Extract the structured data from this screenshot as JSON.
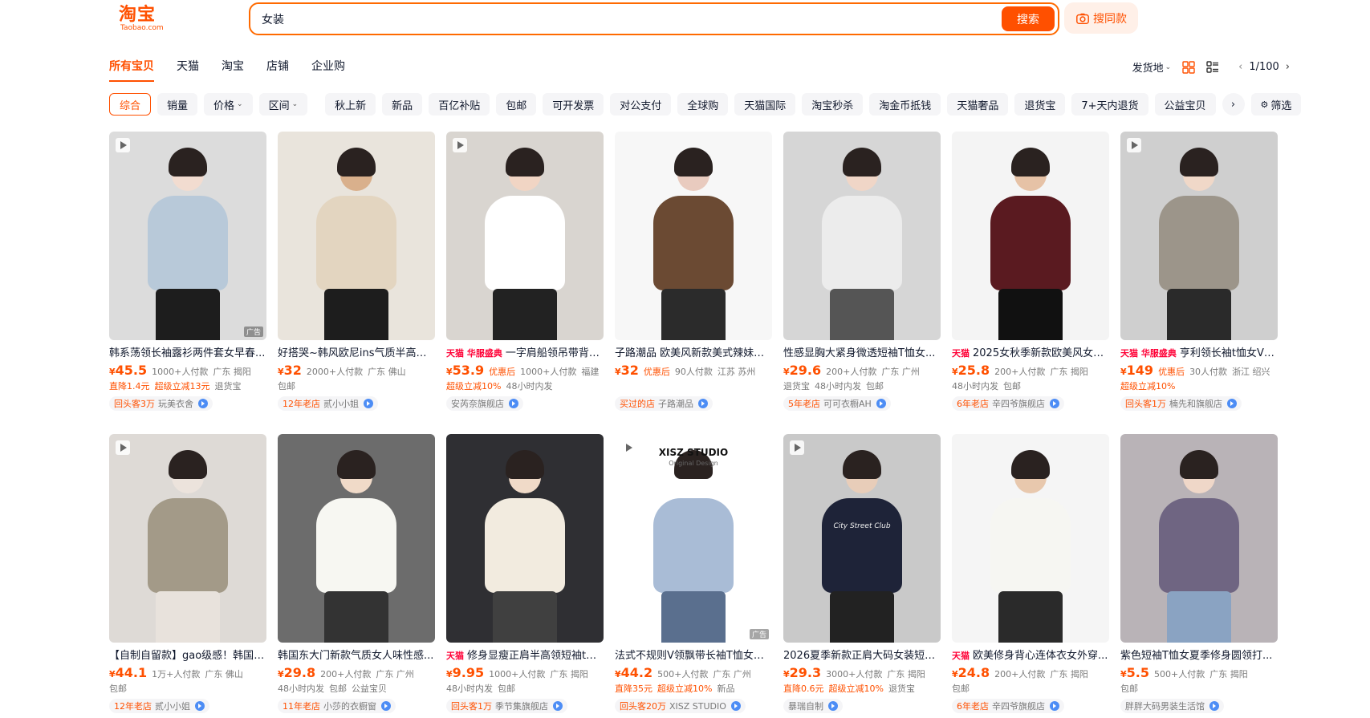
{
  "header": {
    "logo_cn": "淘宝",
    "logo_en": "Taobao.com",
    "search_value": "女装",
    "search_button": "搜索",
    "same_style_button": "搜同款"
  },
  "tabs": [
    "所有宝贝",
    "天猫",
    "淘宝",
    "店铺",
    "企业购"
  ],
  "tools": {
    "ship_from": "发货地",
    "page": "1/100"
  },
  "filters": {
    "sort": [
      "综合",
      "销量",
      "价格",
      "区间"
    ],
    "tags": [
      "秋上新",
      "新品",
      "百亿补贴",
      "包邮",
      "可开发票",
      "对公支付",
      "全球购",
      "天猫国际",
      "淘宝秒杀",
      "淘金币抵钱",
      "天猫奢品",
      "退货宝",
      "7+天内退货",
      "公益宝贝"
    ],
    "filter_button": "筛选"
  },
  "products": [
    {
      "title": "韩系荡领长袖露衫两件套女早春...",
      "price": "45.5",
      "coupon": "",
      "sales": "1000+人付款",
      "loc": "广东 揭阳",
      "tags_o": [
        "直降1.4元",
        "超级立减13元"
      ],
      "tags": [
        "退货宝"
      ],
      "shop_badge": "回头客3万",
      "shop": "玩美衣舍",
      "badge": "",
      "video": true,
      "ad": true
    },
    {
      "title": "好搭哭~韩风欧尼ins气质半高领...",
      "price": "32",
      "coupon": "",
      "sales": "2000+人付款",
      "loc": "广东 佛山",
      "tags_o": [],
      "tags": [
        "包邮"
      ],
      "shop_badge": "12年老店",
      "shop": "贰小小姐",
      "badge": "",
      "video": false,
      "ad": false
    },
    {
      "title": "一字肩船领吊带背心...",
      "price": "53.9",
      "coupon": "优惠后",
      "sales": "1000+人付款",
      "loc": "福建",
      "tags_o": [
        "超级立减10%"
      ],
      "tags": [
        "48小时内发"
      ],
      "shop_badge": "",
      "shop": "安芮奈旗舰店",
      "badge": "天猫 华服盛典",
      "video": true,
      "ad": false
    },
    {
      "title": "子路潮品 欧美风新款美式辣妹半...",
      "price": "32",
      "coupon": "优惠后",
      "sales": "90人付款",
      "loc": "江苏 苏州",
      "tags_o": [],
      "tags": [],
      "shop_badge": "买过的店",
      "shop": "子路潮品",
      "badge": "",
      "video": false,
      "ad": false
    },
    {
      "title": "性感显胸大紧身微透短袖T恤女...",
      "price": "29.6",
      "coupon": "",
      "sales": "200+人付款",
      "loc": "广东 广州",
      "tags_o": [],
      "tags": [
        "退货宝",
        "48小时内发",
        "包邮"
      ],
      "shop_badge": "5年老店",
      "shop": "可可衣橱AH",
      "badge": "",
      "video": false,
      "ad": false
    },
    {
      "title": "2025女秋季新款欧美风女装...",
      "price": "25.8",
      "coupon": "",
      "sales": "200+人付款",
      "loc": "广东 揭阳",
      "tags_o": [],
      "tags": [
        "48小时内发",
        "包邮"
      ],
      "shop_badge": "6年老店",
      "shop": "辛四爷旗舰店",
      "badge": "天猫",
      "video": false,
      "ad": false
    },
    {
      "title": "亨利领长袖t恤女V领...",
      "price": "149",
      "coupon": "优惠后",
      "sales": "30人付款",
      "loc": "浙江 绍兴",
      "tags_o": [
        "超级立减10%"
      ],
      "tags": [],
      "shop_badge": "回头客1万",
      "shop": "楠先和旗舰店",
      "badge": "天猫 华服盛典",
      "video": true,
      "ad": false
    },
    {
      "title": "【自制自留款】gao级感！韩国in...",
      "price": "44.1",
      "coupon": "",
      "sales": "1万+人付款",
      "loc": "广东 佛山",
      "tags_o": [],
      "tags": [
        "包邮"
      ],
      "shop_badge": "12年老店",
      "shop": "贰小小姐",
      "badge": "",
      "video": true,
      "ad": false
    },
    {
      "title": "韩国东大门新款气质女人味性感...",
      "price": "29.8",
      "coupon": "",
      "sales": "200+人付款",
      "loc": "广东 广州",
      "tags_o": [],
      "tags": [
        "48小时内发",
        "包邮",
        "公益宝贝"
      ],
      "shop_badge": "11年老店",
      "shop": "小莎的衣橱窗",
      "badge": "",
      "video": false,
      "ad": false
    },
    {
      "title": "修身显瘦正肩半高领短袖t恤...",
      "price": "9.95",
      "coupon": "",
      "sales": "1000+人付款",
      "loc": "广东 揭阳",
      "tags_o": [],
      "tags": [
        "48小时内发",
        "包邮"
      ],
      "shop_badge": "回头客1万",
      "shop": "季节集旗舰店",
      "badge": "天猫",
      "video": false,
      "ad": false
    },
    {
      "title": "法式不规则V领飘带长袖T恤女春...",
      "price": "44.2",
      "coupon": "",
      "sales": "500+人付款",
      "loc": "广东 广州",
      "tags_o": [
        "直降35元",
        "超级立减10%"
      ],
      "tags": [
        "新品"
      ],
      "shop_badge": "回头客20万",
      "shop": "XISZ STUDIO",
      "badge": "",
      "video": true,
      "ad": true
    },
    {
      "title": "2026夏季新款正肩大码女装短袖t...",
      "price": "29.3",
      "coupon": "",
      "sales": "3000+人付款",
      "loc": "广东 揭阳",
      "tags_o": [
        "直降0.6元",
        "超级立减10%"
      ],
      "tags": [
        "退货宝"
      ],
      "shop_badge": "",
      "shop": "暴瑞自制",
      "badge": "",
      "video": true,
      "ad": false
    },
    {
      "title": "欧美修身背心连体衣女外穿...",
      "price": "24.8",
      "coupon": "",
      "sales": "200+人付款",
      "loc": "广东 揭阳",
      "tags_o": [],
      "tags": [
        "包邮"
      ],
      "shop_badge": "6年老店",
      "shop": "辛四爷旗舰店",
      "badge": "天猫",
      "video": false,
      "ad": false
    },
    {
      "title": "紫色短袖T恤女夏季修身圆领打...",
      "price": "5.5",
      "coupon": "",
      "sales": "500+人付款",
      "loc": "广东 揭阳",
      "tags_o": [],
      "tags": [
        "包邮"
      ],
      "shop_badge": "",
      "shop": "胖胖大码男装生活馆",
      "badge": "",
      "video": false,
      "ad": false
    }
  ],
  "product_image_labels": {
    "studio_brand": "XISZ STUDIO",
    "studio_sub": "Original Design",
    "ad_mark": "广告",
    "tshirt_text": "City Street Club"
  },
  "colors": {
    "accent": "#ff5000",
    "tmall": "#ff0036"
  }
}
